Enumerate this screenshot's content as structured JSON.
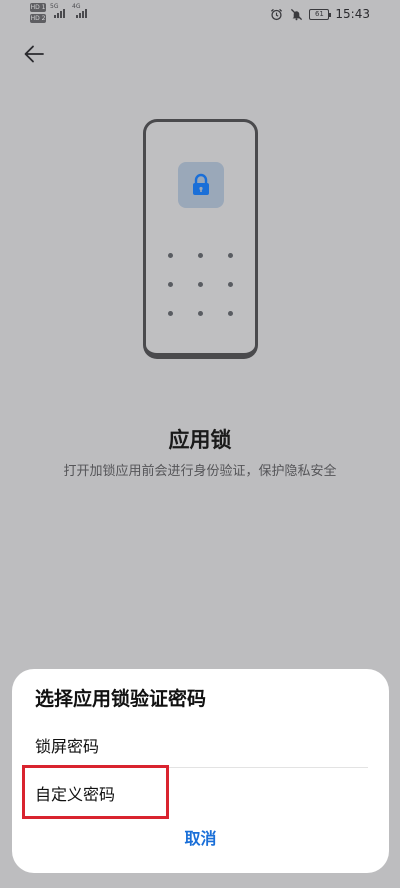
{
  "status_bar": {
    "sim1_badge": "HD 1",
    "sim2_badge": "HD 2",
    "network1": "5G",
    "network2": "4G",
    "alarm_icon": "alarm-icon",
    "mute_icon": "mute-icon",
    "battery_level": "61",
    "time": "15:43"
  },
  "header": {
    "back_icon": "back-arrow-icon"
  },
  "illustration": {
    "lock_icon": "lock-icon",
    "accent_color": "#1a6fd8"
  },
  "main": {
    "title": "应用锁",
    "subtitle": "打开加锁应用前会进行身份验证，保护隐私安全"
  },
  "sheet": {
    "title": "选择应用锁验证密码",
    "options": [
      {
        "label": "锁屏密码"
      },
      {
        "label": "自定义密码"
      }
    ],
    "cancel_label": "取消",
    "highlight_color": "#d9232f"
  }
}
